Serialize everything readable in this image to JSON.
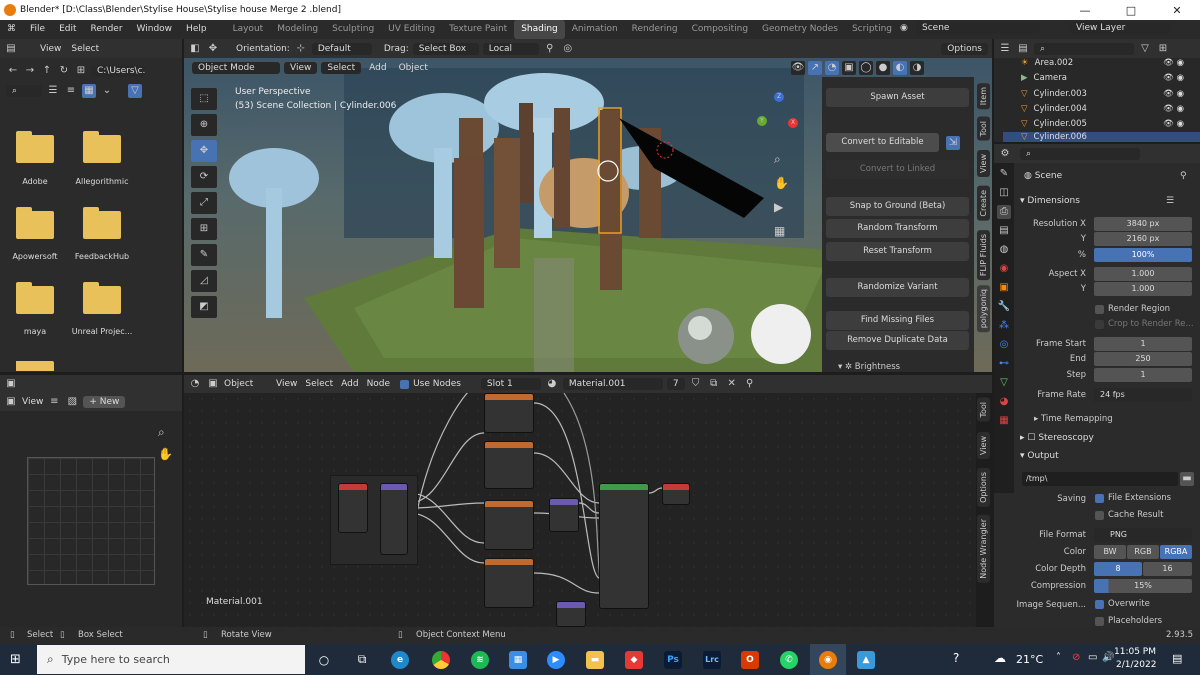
{
  "window": {
    "title": "Blender* [D:\\Class\\Blender\\Stylise House\\Stylise house Merge 2 .blend]",
    "minimize": "—",
    "maximize": "□",
    "close": "✕"
  },
  "menu": [
    "File",
    "Edit",
    "Render",
    "Window",
    "Help"
  ],
  "workspaces": [
    "Layout",
    "Modeling",
    "Sculpting",
    "UV Editing",
    "Texture Paint",
    "Shading",
    "Animation",
    "Rendering",
    "Compositing",
    "Geometry Nodes",
    "Scripting"
  ],
  "active_workspace": "Shading",
  "scene": {
    "label": "Scene",
    "view_layer": "View Layer"
  },
  "filebrowser": {
    "view": "View",
    "select": "Select",
    "path": "C:\\Users\\c...",
    "folders": [
      "Adobe",
      "Allegorithmic",
      "Apowersoft",
      "FeedbackHub",
      "maya",
      "Unreal Projec..."
    ]
  },
  "viewport_header": {
    "orientation_label": "Orientation:",
    "orientation": "Default",
    "drag_label": "Drag:",
    "drag": "Select Box",
    "pivot": "Local",
    "options": "Options",
    "mode": "Object Mode",
    "view": "View",
    "select": "Select",
    "add": "Add",
    "object": "Object"
  },
  "viewport": {
    "perspective": "User Perspective",
    "collection": "(53) Scene Collection | Cylinder.006"
  },
  "npanel": {
    "buttons": [
      "Spawn Asset",
      "Convert to Editable",
      "Convert to Linked",
      "Snap to Ground (Beta)",
      "Random Transform",
      "Reset Transform",
      "Randomize Variant",
      "Find Missing Files",
      "Remove Duplicate Data"
    ],
    "brightness": "Brightness",
    "tabs": [
      "Item",
      "Tool",
      "View",
      "Create",
      "FLIP Fluids",
      "polygoniq"
    ]
  },
  "outliner": {
    "items": [
      "Area.002",
      "Camera",
      "Cylinder.003",
      "Cylinder.004",
      "Cylinder.005",
      "Cylinder.006"
    ]
  },
  "properties": {
    "scene": "Scene",
    "dimensions": "Dimensions",
    "res_x_label": "Resolution X",
    "res_x": "3840 px",
    "res_y_label": "Y",
    "res_y": "2160 px",
    "pct_label": "%",
    "pct": "100%",
    "aspect_x_label": "Aspect X",
    "aspect_x": "1.000",
    "aspect_y_label": "Y",
    "aspect_y": "1.000",
    "render_region": "Render Region",
    "crop": "Crop to Render Re...",
    "frame_start_label": "Frame Start",
    "frame_start": "1",
    "end_label": "End",
    "end": "250",
    "step_label": "Step",
    "step": "1",
    "frame_rate_label": "Frame Rate",
    "frame_rate": "24 fps",
    "time_remapping": "Time Remapping",
    "stereoscopy": "Stereoscopy",
    "output": "Output",
    "output_path": "/tmp\\",
    "saving_label": "Saving",
    "file_extensions": "File Extensions",
    "cache_result": "Cache Result",
    "file_format_label": "File Format",
    "file_format": "PNG",
    "color_label": "Color",
    "color_opts": [
      "BW",
      "RGB",
      "RGBA"
    ],
    "depth_label": "Color Depth",
    "depth_opts": [
      "8",
      "16"
    ],
    "compression_label": "Compression",
    "compression": "15%",
    "image_seq_label": "Image Sequen...",
    "overwrite": "Overwrite",
    "placeholders": "Placeholders"
  },
  "image_editor": {
    "view": "View",
    "new": "New"
  },
  "node_header": {
    "object": "Object",
    "view": "View",
    "select": "Select",
    "add": "Add",
    "node": "Node",
    "use_nodes": "Use Nodes",
    "slot": "Slot 1",
    "material": "Material.001",
    "users": "7"
  },
  "node_editor": {
    "material_label": "Material.001",
    "tabs": [
      "Tool",
      "View",
      "Options",
      "Node Wrangler"
    ]
  },
  "statusbar": {
    "select": "Select",
    "box_select": "Box Select",
    "rotate": "Rotate View",
    "context": "Object Context Menu",
    "version": "2.93.5"
  },
  "taskbar": {
    "search_placeholder": "Type here to search",
    "temp": "21°C",
    "time": "11:05 PM",
    "date": "2/1/2022",
    "apps": [
      "Ps",
      "Lrc"
    ]
  },
  "colors": {
    "accent": "#4772b3",
    "folder": "#e8c15a",
    "taskbar": "#1f2a3a"
  }
}
